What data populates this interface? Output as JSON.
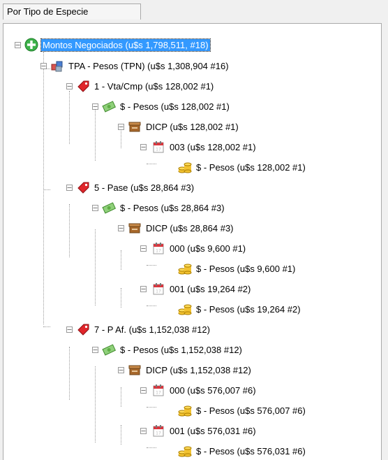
{
  "tab": {
    "label": "Por Tipo de Especie"
  },
  "tree": {
    "root": {
      "label": "Montos Negociados (u$s 1,798,511, #18)"
    },
    "tpa": {
      "label": "TPA - Pesos (TPN) (u$s 1,308,904  #16)"
    },
    "op1": {
      "label": "1 - Vta/Cmp  (u$s 128,002  #1)",
      "currency": "$ - Pesos  (u$s 128,002  #1)",
      "dicp": "DICP  (u$s 128,002  #1)",
      "d003": "003  (u$s 128,002  #1)",
      "leaf003": "$ - Pesos  (u$s 128,002  #1)"
    },
    "op5": {
      "label": "5 - Pase (u$s 28,864  #3)",
      "currency": "$ - Pesos  (u$s 28,864  #3)",
      "dicp": "DICP  (u$s 28,864  #3)",
      "d000": "000  (u$s 9,600  #1)",
      "leaf000": "$ - Pesos  (u$s 9,600  #1)",
      "d001": "001 (u$s 19,264  #2)",
      "leaf001": "$ - Pesos  (u$s 19,264  #2)"
    },
    "op7": {
      "label": "7 - P Af. (u$s 1,152,038  #12)",
      "currency": "$ - Pesos  (u$s 1,152,038  #12)",
      "dicp": "DICP  (u$s 1,152,038  #12)",
      "d000": "000 (u$s 576,007  #6)",
      "leaf000": "$ - Pesos  (u$s 576,007  #6)",
      "d001": "001 (u$s 576,031  #6)",
      "leaf001": "$ - Pesos  (u$s 576,031  #6)"
    }
  }
}
